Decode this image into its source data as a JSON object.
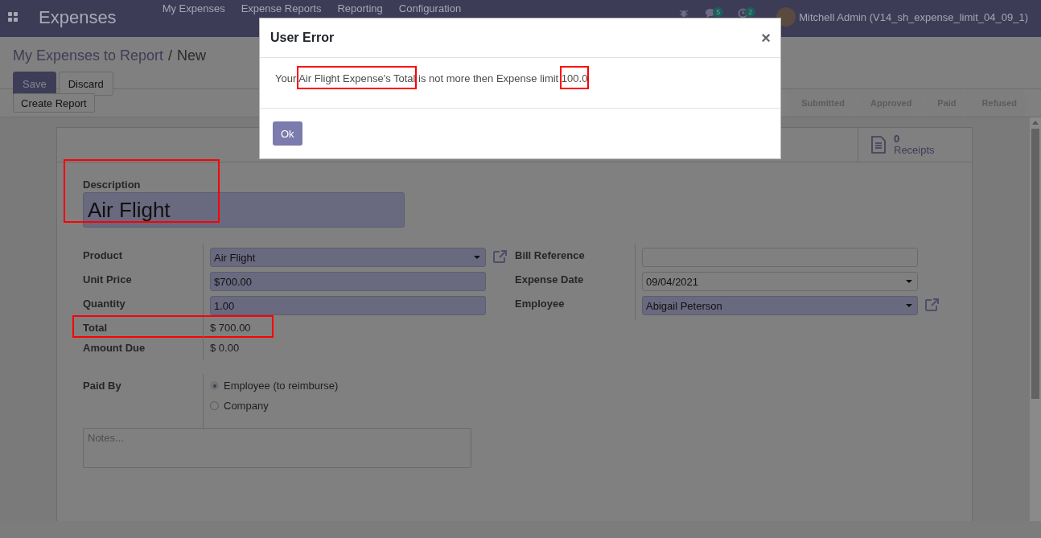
{
  "navbar": {
    "app_name": "Expenses",
    "menu": [
      "My Expenses",
      "Expense Reports",
      "Reporting",
      "Configuration"
    ],
    "chat_count": "5",
    "activity_count": "2",
    "user": "Mitchell Admin (V14_sh_expense_limit_04_09_1)"
  },
  "breadcrumb": {
    "parent": "My Expenses to Report",
    "separator": "/",
    "current": "New"
  },
  "buttons": [
    {
      "label": "Save",
      "kind": "primary"
    },
    {
      "label": "Discard",
      "kind": "secondary"
    }
  ],
  "action_button": "Create Report",
  "stages": [
    {
      "label": "Submitted",
      "selected": false
    },
    {
      "label": "Approved",
      "selected": false
    },
    {
      "label": "Paid",
      "selected": false
    },
    {
      "label": "Refused",
      "selected": false
    }
  ],
  "receipts": {
    "count": "0",
    "label": "Receipts"
  },
  "description": {
    "label": "Description",
    "value": "Air Flight",
    "highlighted": true
  },
  "left_fields": [
    {
      "label": "Product",
      "value": "Air Flight",
      "kind": "select",
      "required": true,
      "external_link": true,
      "highlighted": false
    },
    {
      "label": "Unit Price",
      "value": "$700.00",
      "kind": "input",
      "required": true,
      "external_link": false,
      "highlighted": false
    },
    {
      "label": "Quantity",
      "value": "1.00",
      "kind": "input",
      "required": true,
      "external_link": false,
      "highlighted": false
    },
    {
      "label": "Total",
      "value": "$ 700.00",
      "kind": "readonly",
      "external_link": false,
      "highlighted": true
    },
    {
      "label": "Amount Due",
      "value": "$ 0.00",
      "kind": "readonly",
      "external_link": false,
      "highlighted": false
    }
  ],
  "right_fields": [
    {
      "label": "Bill Reference",
      "kind": "input",
      "required": false,
      "external_link": false,
      "highlighted": false
    },
    {
      "label": "Expense Date",
      "value": "09/04/2021",
      "kind": "select",
      "required": false,
      "external_link": false,
      "highlighted": false
    },
    {
      "label": "Employee",
      "value": "Abigail Peterson",
      "kind": "select",
      "required": true,
      "external_link": true,
      "highlighted": false
    }
  ],
  "paid_by": {
    "label": "Paid By",
    "options": [
      {
        "label": "Employee (to reimburse)",
        "selected": true
      },
      {
        "label": "Company",
        "selected": false
      }
    ]
  },
  "notes": {
    "placeholder": "Notes..."
  },
  "dialog": {
    "title": "User Error",
    "close": "×",
    "message": [
      {
        "text": "Your ",
        "highlighted": false
      },
      {
        "text": "Air Flight Expense's Total",
        "highlighted": true
      },
      {
        "text": " is not more then Expense limit ",
        "highlighted": false
      },
      {
        "text": "100.0",
        "highlighted": true
      }
    ],
    "button": "Ok"
  }
}
